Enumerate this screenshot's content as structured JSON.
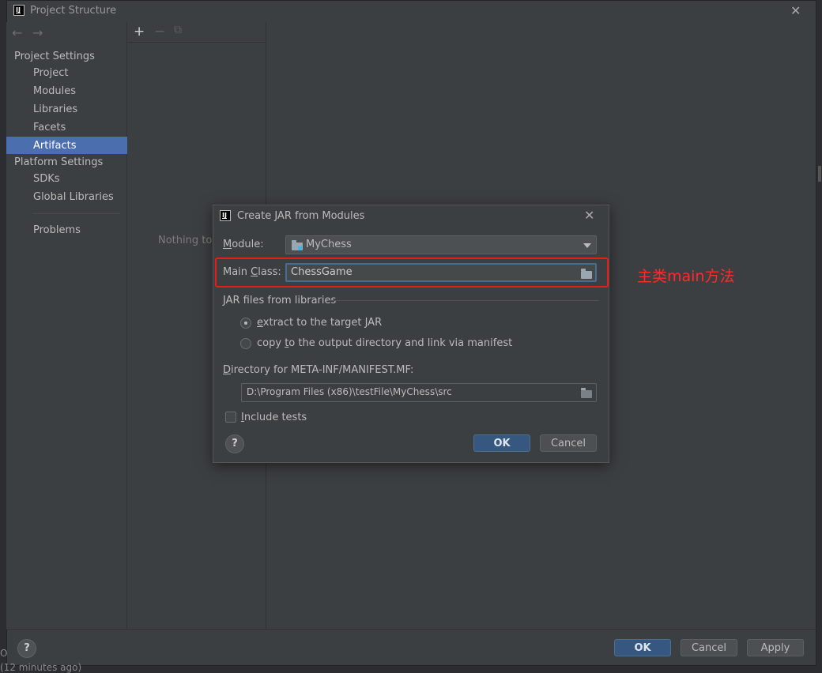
{
  "window": {
    "title": "Project Structure",
    "logo_text": "IJ",
    "close_glyph": "✕",
    "back_glyph": "←",
    "forward_glyph": "→"
  },
  "nav": {
    "project_settings": "Project Settings",
    "project_items": [
      "Project",
      "Modules",
      "Libraries",
      "Facets",
      "Artifacts"
    ],
    "selected_item": "Artifacts",
    "platform_settings": "Platform Settings",
    "platform_items": [
      "SDKs",
      "Global Libraries"
    ],
    "problems": "Problems"
  },
  "toolbar": {
    "add_glyph": "+",
    "remove_glyph": "−",
    "copy_glyph": "⧉"
  },
  "mid_panel": {
    "empty_text": "Nothing to s"
  },
  "bottom_bar": {
    "help_glyph": "?",
    "ok_label": "OK",
    "cancel_label": "Cancel",
    "apply_label": "Apply"
  },
  "status": {
    "edge_letter": "O",
    "time_text": "(12 minutes ago)"
  },
  "dialog": {
    "title": "Create JAR from Modules",
    "logo_text": "IJ",
    "close_glyph": "✕",
    "module_label_mnemonic": "M",
    "module_label_rest": "odule:",
    "module_value": "MyChess",
    "main_class_label_pre": "Main ",
    "main_class_label_mnemonic": "C",
    "main_class_label_rest": "lass:",
    "main_class_value": "ChessGame",
    "jar_group_title": "JAR files from libraries",
    "radio_extract_mnemonic": "e",
    "radio_extract_rest": "xtract to the target JAR",
    "radio_copy_pre": "copy ",
    "radio_copy_mnemonic": "t",
    "radio_copy_rest": "o the output directory and link via manifest",
    "selected_option": "extract to the target JAR",
    "manifest_label_mnemonic": "D",
    "manifest_label_rest": "irectory for META-INF/MANIFEST.MF:",
    "manifest_value": "D:\\Program Files (x86)\\testFile\\MyChess\\src",
    "include_tests_mnemonic": "I",
    "include_tests_rest": "nclude tests",
    "include_tests_checked": false,
    "help_glyph": "?",
    "ok_label": "OK",
    "cancel_label": "Cancel"
  },
  "annotation": {
    "text": "主类main方法",
    "color": "#ff2a2a"
  },
  "colors": {
    "accent_selection": "#4b6eaf",
    "default_button": "#365880",
    "highlight_box": "#e81b1b"
  }
}
